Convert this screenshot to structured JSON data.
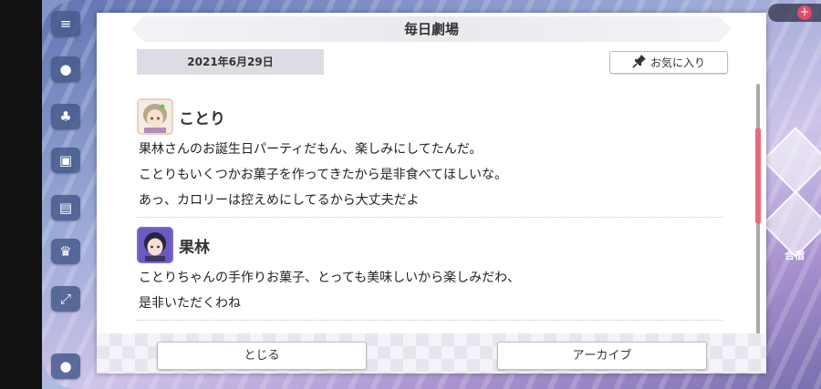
{
  "dialog": {
    "title": "毎日劇場",
    "date": "2021年6月29日",
    "favorite_label": "お気に入り",
    "messages": [
      {
        "speaker": "ことり",
        "avatar": "kotori-avatar",
        "lines": [
          "果林さんのお誕生日パーティだもん、楽しみにしてたんだ。",
          "ことりもいくつかお菓子を作ってきたから是非食べてほしいな。",
          "あっ、カロリーは控えめにしてるから大丈夫だよ"
        ]
      },
      {
        "speaker": "果林",
        "avatar": "karin-avatar",
        "lines": [
          "ことりちゃんの手作りお菓子、とっても美味しいから楽しみだわ、",
          "是非いただくわね"
        ]
      }
    ],
    "close_label": "とじる",
    "archive_label": "アーカイブ"
  },
  "background": {
    "right_label": "合宿"
  },
  "colors": {
    "scroll_thumb": "#e86a7a",
    "date_bg": "#dcdde4",
    "badge_plus": "#e24a6a"
  },
  "icons": {
    "favorite": "pin-icon",
    "rail": [
      "menu-icon",
      "chat-icon",
      "shirt-icon",
      "gift-icon",
      "board-icon",
      "trophy-icon",
      "expand-icon",
      "profile-icon"
    ]
  }
}
